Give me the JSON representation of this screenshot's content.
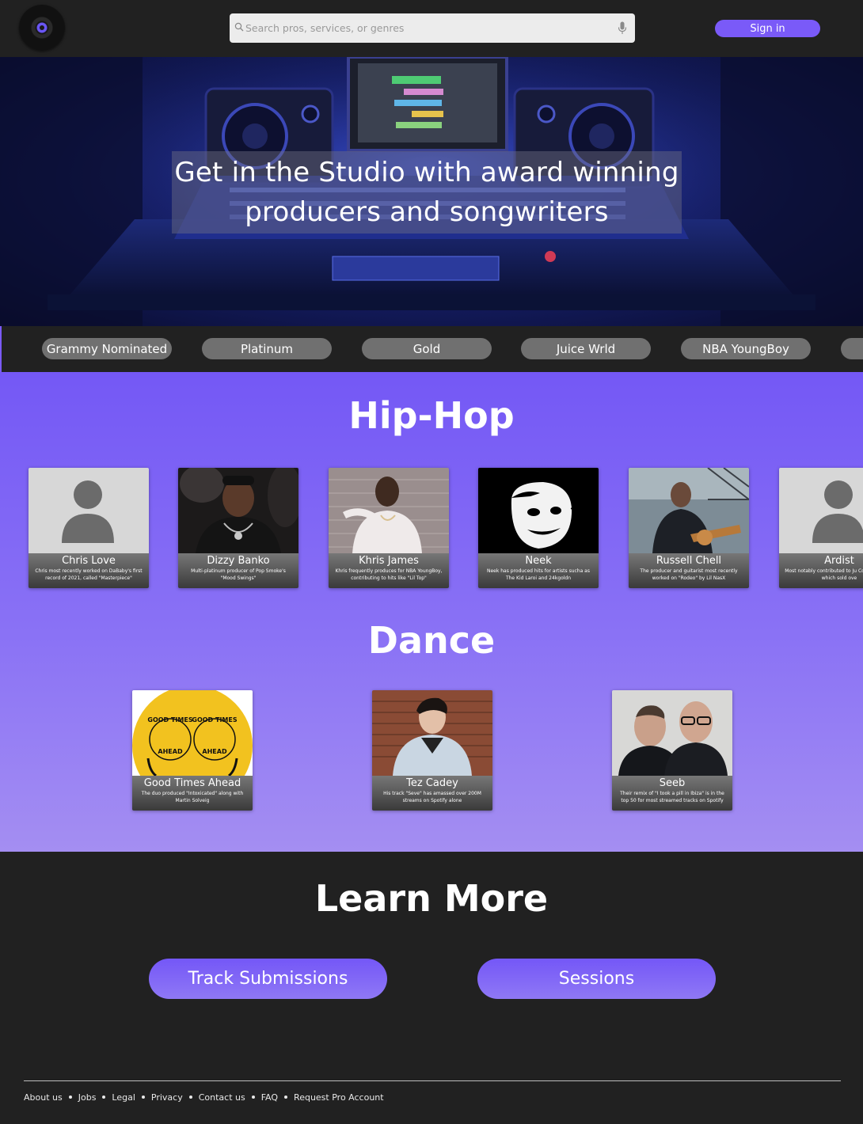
{
  "header": {
    "search_placeholder": "Search pros, services, or genres",
    "signin_label": "Sign in",
    "accent_color": "#7a5af8"
  },
  "hero": {
    "title": "Get in the Studio with award winning producers and songwriters"
  },
  "tags": [
    "Grammy Nominated",
    "Platinum",
    "Gold",
    "Juice Wrld",
    "NBA YoungBoy"
  ],
  "sections": [
    {
      "title": "Hip-Hop",
      "cards": [
        {
          "name": "Chris Love",
          "desc": "Chris most recently worked on DaBaby's first record of 2021, called \"Masterpiece\""
        },
        {
          "name": "Dizzy Banko",
          "desc": "Multi-platinum producer of Pop Smoke's \"Mood Swings\""
        },
        {
          "name": "Khris James",
          "desc": "Khris frequently produces for NBA YoungBoy, contributing to hits like \"Lil Top\""
        },
        {
          "name": "Neek",
          "desc": "Neek has produced hits for artists sucha as The Kid Laroi and 24kgoldn"
        },
        {
          "name": "Russell Chell",
          "desc": "The producer and guitarist most recently worked on \"Rodeo\" by Lil NasX"
        },
        {
          "name": "Ardist",
          "desc": "Most notably contributed to Ju Conversations, which sold ove"
        }
      ]
    },
    {
      "title": "Dance",
      "cards": [
        {
          "name": "Good Times Ahead",
          "desc": "The duo produced \"Intoxicated\" along with Martin Solveig",
          "logo_text": "GOOD TIMES AHEAD"
        },
        {
          "name": "Tez Cadey",
          "desc": "His track \"Seve\" has amassed over 200M streams on Spotify alone"
        },
        {
          "name": "Seeb",
          "desc": "Their remix of \"I took a pill in Ibiza\" is in the top 50 for most streamed tracks on Spotify"
        }
      ]
    }
  ],
  "learn_more": {
    "title": "Learn More",
    "buttons": [
      "Track Submissions",
      "Sessions"
    ]
  },
  "footer": {
    "links": [
      "About us",
      "Jobs",
      "Legal",
      "Privacy",
      "Contact us",
      "FAQ",
      "Request Pro Account"
    ]
  }
}
